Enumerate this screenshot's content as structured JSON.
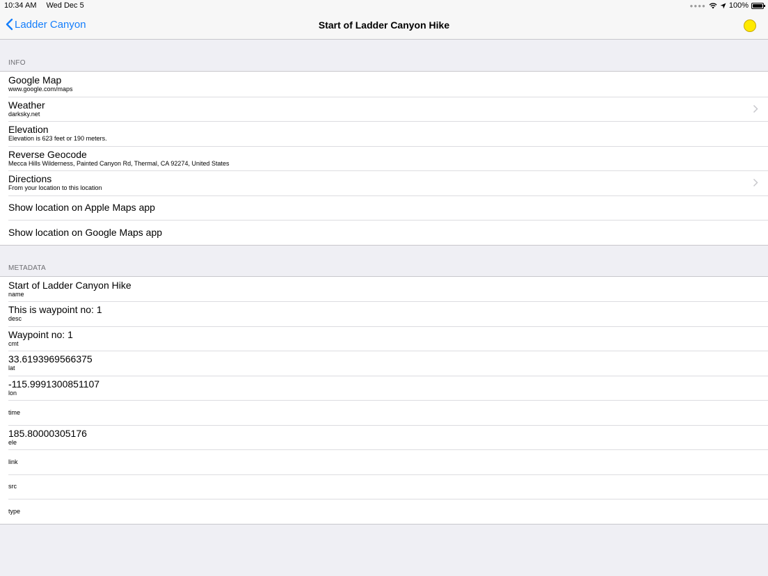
{
  "status_bar": {
    "time": "10:34 AM",
    "date": "Wed Dec 5",
    "battery": "100%"
  },
  "nav": {
    "back_label": "Ladder Canyon",
    "title": "Start of Ladder Canyon Hike",
    "status_dot_color": "#ffea00"
  },
  "info": {
    "header": "INFO",
    "rows": [
      {
        "title": "Google Map",
        "subtitle": "www.google.com/maps"
      },
      {
        "title": "Weather",
        "subtitle": "darksky.net"
      },
      {
        "title": "Elevation",
        "subtitle": "Elevation is 623 feet or 190 meters."
      },
      {
        "title": "Reverse Geocode",
        "subtitle": "Mecca Hills Wilderness, Painted Canyon Rd, Thermal, CA  92274, United States"
      },
      {
        "title": "Directions",
        "subtitle": "From your location to this location"
      },
      {
        "title": "Show location on Apple Maps app"
      },
      {
        "title": "Show location on Google Maps app"
      }
    ]
  },
  "metadata": {
    "header": "METADATA",
    "rows": [
      {
        "value": "Start of Ladder Canyon Hike",
        "key": "name"
      },
      {
        "value": "This is waypoint no: 1",
        "key": "desc"
      },
      {
        "value": "Waypoint no: 1",
        "key": "cmt"
      },
      {
        "value": "33.6193969566375",
        "key": "lat"
      },
      {
        "value": "-115.9991300851107",
        "key": "lon"
      },
      {
        "key": "time"
      },
      {
        "value": "185.80000305176",
        "key": "ele"
      },
      {
        "key": "link"
      },
      {
        "key": "src"
      },
      {
        "key": "type"
      }
    ]
  }
}
